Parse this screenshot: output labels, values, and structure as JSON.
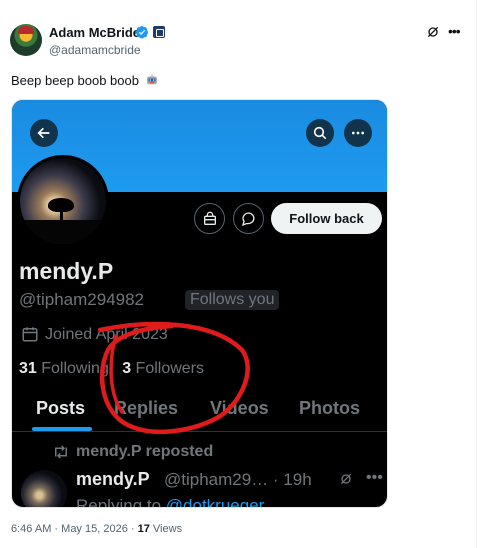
{
  "tweet": {
    "author_name": "Adam McBride",
    "author_handle": "@adamamcbride",
    "text": "Beep beep boob boob",
    "text_emoji_icon": "robot-icon",
    "time": "6:46 AM",
    "separator": "·",
    "date": "May 15, 2026",
    "views_count": "17",
    "views_label": "Views"
  },
  "colors": {
    "accent": "#1d9bf0",
    "annotation": "#e01b1b",
    "dark_bg": "#000000"
  },
  "media": {
    "profile": {
      "name": "mendy.P",
      "handle": "@tipham294982",
      "follows_you": "Follows you",
      "joined": "Joined April 2023",
      "following_count": "31",
      "following_label": "Following",
      "followers_count": "3",
      "followers_label": "Followers",
      "follow_back_label": "Follow back"
    },
    "tabs": [
      "Posts",
      "Replies",
      "Videos",
      "Photos"
    ],
    "active_tab": "Posts",
    "post": {
      "repost_label": "mendy.P reposted",
      "author": "mendy.P",
      "handle_time": "@tipham29… · 19h",
      "replying_prefix": "Replying to",
      "replying_mention": "@dotkrueger"
    }
  }
}
